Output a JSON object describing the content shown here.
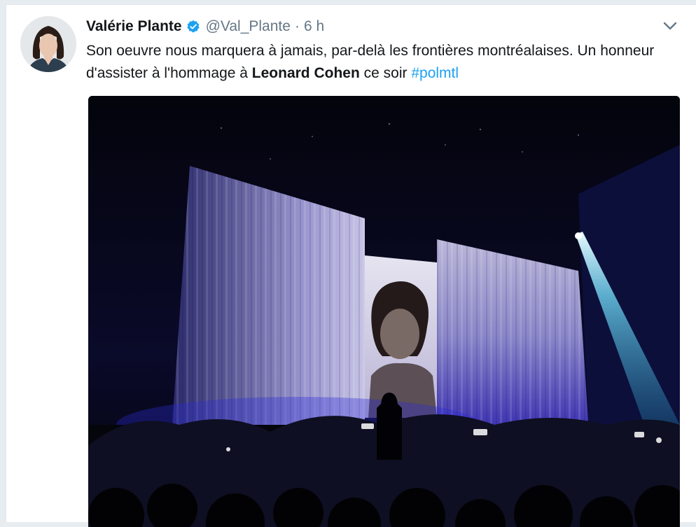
{
  "tweet": {
    "author_name": "Valérie Plante",
    "handle": "@Val_Plante",
    "separator": "·",
    "time": "6 h",
    "text_part1": "Son oeuvre nous marquera à jamais, par-delà les frontières montréalaises. Un honneur d'assister à l'hommage à ",
    "text_bold": "Leonard Cohen",
    "text_part2": " ce soir ",
    "hashtag": "#polmtl"
  },
  "icons": {
    "verified": "verified-badge-icon",
    "menu": "chevron-down-icon"
  },
  "colors": {
    "link": "#1da1f2",
    "secondary_text": "#657786",
    "primary_text": "#14171a",
    "verified": "#1da1f2"
  }
}
